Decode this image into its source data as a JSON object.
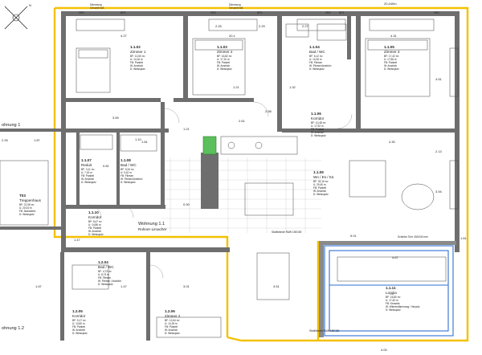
{
  "north_arrow": {
    "label": "N"
  },
  "top_labels": {
    "left_note_a": "Dämmung",
    "left_note_b": "Gesamtmaß",
    "mid_note_a": "Dämmung",
    "mid_note_b": "Gesamtmaß",
    "door_codes": [
      "VRG",
      "NFS",
      "VRG",
      "NFS",
      "VRG",
      "NFS",
      "VRG"
    ],
    "top_right_dim": "20,440m"
  },
  "rooms": [
    {
      "id": "1.1.02",
      "name": "Zimmer 1",
      "lines": [
        "BF: 12,50 m²",
        "U: 14,16 m",
        "FB: Parkett",
        "W: Anstrich",
        "D: Weissputz"
      ]
    },
    {
      "id": "1.1.03",
      "name": "Zimmer 2",
      "lines": [
        "BF: 16,82 m²",
        "U: 17,10 m",
        "FB: Parkett",
        "W: Anstrich",
        "D: Weissputz"
      ]
    },
    {
      "id": "1.1.04",
      "name": "Bad / WC",
      "lines": [
        "BF: 6,12 m²",
        "U: 10,26 m",
        "FB: Fliesen",
        "W: Fliesen/Anstrich",
        "D: Weissputz"
      ]
    },
    {
      "id": "1.1.05",
      "name": "Zimmer 3",
      "lines": [
        "BF: 17,42 m²",
        "U: 17,66 m",
        "FB: Parkett",
        "W: Anstrich",
        "D: Weissputz"
      ]
    },
    {
      "id": "1.1.06",
      "name": "Korridor",
      "lines": [
        "BF: 10,48 m²",
        "U: 17,92 m",
        "FB: Parkett",
        "W: Anstrich",
        "D: Weissputz"
      ]
    },
    {
      "id": "1.1.07",
      "name": "Reduit",
      "lines": [
        "BF: 3,11 m²",
        "U: 7,16 m",
        "FB: Parkett",
        "W: Anstrich",
        "D: Weissputz"
      ]
    },
    {
      "id": "1.1.08",
      "name": "Bad / WC",
      "lines": [
        "BF: 5,34 m²",
        "U: 9,42 m",
        "FB: Fliesen",
        "W: Fliesen/Anstrich",
        "D: Weissputz"
      ]
    },
    {
      "id": "1.1.09",
      "name": "Wo / Es / Kü",
      "lines": [
        "BF: 42,16 m²",
        "U: 29,40 m",
        "FB: Parkett",
        "W: Anstrich",
        "D: Weissputz"
      ]
    },
    {
      "id": "1.1.10",
      "name": "Korridor",
      "lines": [
        "BF: 8,47 m²",
        "U: 14,86 m",
        "FB: Parkett",
        "W: Anstrich",
        "D: Weissputz"
      ]
    },
    {
      "id": "1.1.11",
      "name": "Loggia",
      "lines": [
        "BF: 16,80 m²",
        "U: 17,40 m",
        "FB: Keramik",
        "W: Wärmedämmung / Verputz",
        "D: Weissputz"
      ]
    },
    {
      "id": "1.2.04",
      "name": "Bad / WC",
      "lines": [
        "BF: 4,73 m²",
        "U: 8,74 m",
        "FB: Fliesen",
        "W: Fliesen / Anstrich",
        "D: Weissputz"
      ]
    },
    {
      "id": "1.2.05",
      "name": "Korridor",
      "lines": [
        "BF: 9,17 m²",
        "U: 13,60 m",
        "FB: Parkett",
        "W: Anstrich",
        "D: Weissputz"
      ]
    },
    {
      "id": "1.2.06",
      "name": "Zimmer 2",
      "lines": [
        "BF: 12,64 m²",
        "U: 14,18 m",
        "FB: Parkett",
        "W: Anstrich",
        "D: Weissputz"
      ]
    },
    {
      "id": "T03",
      "name": "Treppenhaus",
      "lines": [
        "BF: 21,08 m²",
        "U: 20,04 m",
        "FB: Naturstein",
        "D: Weissputz"
      ]
    }
  ],
  "apartment": {
    "title": "Wohnung 1.1",
    "subtitle": "Rohner-Limacher"
  },
  "apartment_2": {
    "title": "ohnung 1.2"
  },
  "stair_left_label": "ohnung 1",
  "notes": {
    "storage": "Stahlblende RAW 150/150",
    "railing": "Stahlblende RAW 150/150",
    "loggia_sill": "Schiebe-Türe 430/240 mm"
  },
  "dims": {
    "top": [
      "4.27",
      "2.25",
      "20.1",
      "2.29",
      "4.31",
      "2.27"
    ],
    "row_mid": [
      "3.59",
      "2.61",
      "4.30",
      "2.58"
    ],
    "left": [
      "1.87",
      "2.26",
      "1.67",
      "1.47",
      "3.01"
    ],
    "right": [
      "4.51",
      "2.13",
      "3.94",
      "1.61"
    ],
    "bottom": [
      "4.67",
      "4.00",
      "3.51",
      "1.47"
    ],
    "misc": [
      "1.10",
      "1.81",
      "0.81",
      "1.21",
      "0.90",
      "5.01",
      "1.21",
      "1.32"
    ]
  }
}
